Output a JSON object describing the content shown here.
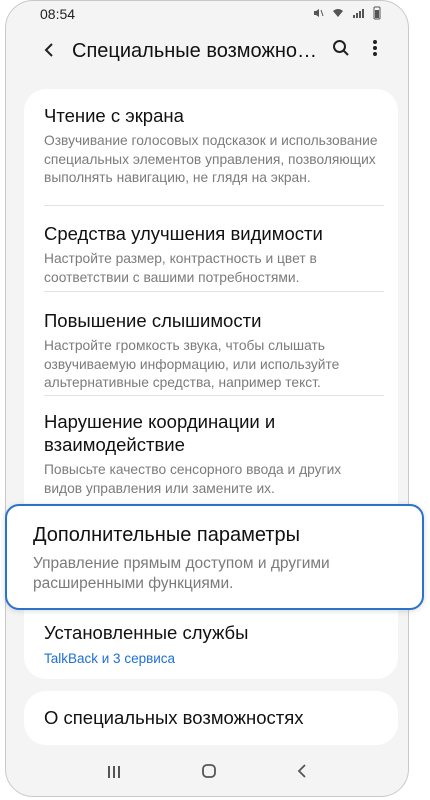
{
  "status": {
    "time": "08:54",
    "icons": [
      "mute-icon",
      "wifi-icon",
      "signal-icon",
      "battery-icon"
    ]
  },
  "appbar": {
    "title": "Специальные возможно…",
    "back_icon": "arrow-left-icon",
    "search_icon": "search-icon",
    "more_icon": "more-vert-icon"
  },
  "items": [
    {
      "title": "Чтение с экрана",
      "desc": "Озвучивание голосовых подсказок и использование специальных элементов управления, позволяющих выполнять навигацию, не глядя на экран."
    },
    {
      "title": "Средства улучшения видимости",
      "desc": "Настройте размер, контрастность и цвет в соответствии с вашими потребностями."
    },
    {
      "title": "Повышение слышимости",
      "desc": "Настройте громкость звука, чтобы слышать озвучиваемую информацию, или используйте альтернативные средства, например текст."
    },
    {
      "title": "Нарушение координации и взаимодействие",
      "desc": "Повысьте качество сенсорного ввода и других видов управления или замените их."
    },
    {
      "title": "Дополнительные параметры",
      "desc": "Управление прямым доступом и другими расширенными функциями."
    },
    {
      "title": "Установленные службы",
      "sub": "TalkBack и 3 сервиса"
    }
  ],
  "about": {
    "title": "О специальных возможностях"
  },
  "navbar": {
    "recents": "recents-icon",
    "home": "home-icon",
    "back": "back-icon"
  }
}
